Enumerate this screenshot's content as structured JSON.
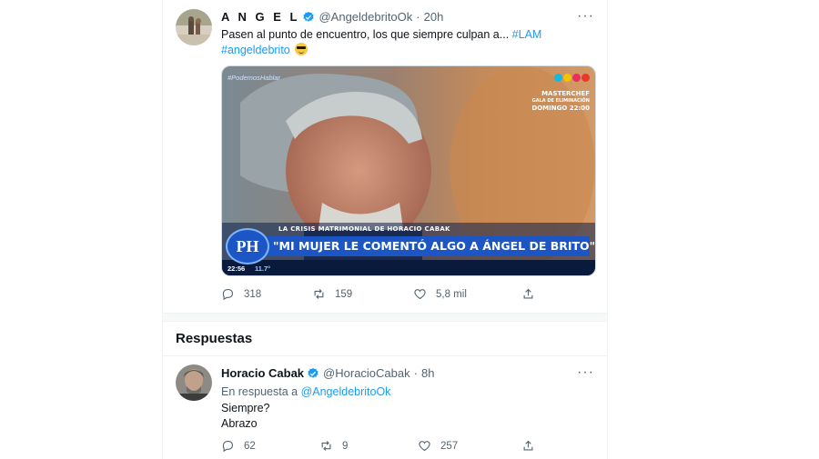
{
  "tweet": {
    "name": "A N G E L",
    "handle": "@AngeldebritoOk",
    "time": "20h",
    "text": "Pasen al punto de encuentro, los que siempre culpan a...",
    "hashtag1": "#LAM",
    "hashtag2": "#angeldebrito",
    "emoji": "sunglasses-emoji",
    "media": {
      "tv_hashtag": "#PodemosHablar",
      "promo_line1": "MASTERCHEF",
      "promo_line2": "GALA DE ELIMINACIÓN",
      "promo_line3": "DOMINGO 22:00",
      "lower_title": "LA CRISIS MATRIMONIAL DE HORACIO CABAK",
      "quote": "\"MI MUJER LE COMENTÓ ALGO A ÁNGEL DE BRITO\"",
      "logo": "PH",
      "clock": "22:56",
      "temperature": "11.7°"
    },
    "replies": "318",
    "retweets": "159",
    "likes": "5,8 mil"
  },
  "section": {
    "title": "Respuestas"
  },
  "reply": {
    "name": "Horacio Cabak",
    "handle": "@HoracioCabak",
    "time": "8h",
    "in_reply_prefix": "En respuesta a",
    "in_reply_handle": "@AngeldebritoOk",
    "line1": "Siempre?",
    "line2": "Abrazo",
    "replies": "62",
    "retweets": "9",
    "likes": "257"
  },
  "colors": {
    "accent": "#1d9bf0",
    "muted": "#536471",
    "text": "#0f1419"
  },
  "icons": [
    "verified-badge-icon",
    "more-icon",
    "reply-icon",
    "retweet-icon",
    "like-icon",
    "share-icon"
  ]
}
